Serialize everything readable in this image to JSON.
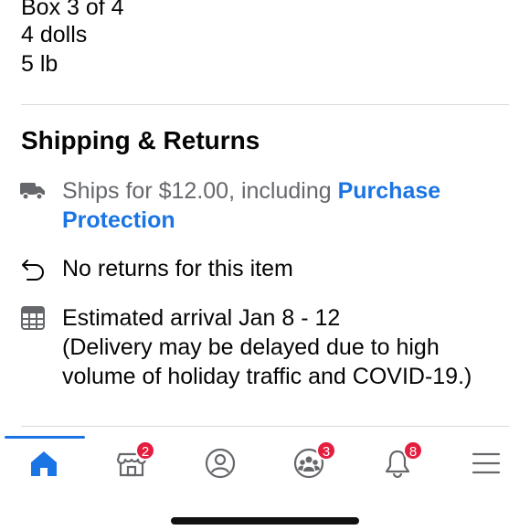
{
  "description": {
    "lines": [
      "Box 3 of 4",
      "4 dolls",
      "5 lb"
    ]
  },
  "shipping": {
    "title": "Shipping & Returns",
    "ships_prefix": "Ships for $12.00, including ",
    "purchase_protection_link": "Purchase Protection",
    "returns_text": "No returns for this item",
    "arrival_text": "Estimated arrival Jan 8 - 12",
    "arrival_note": "(Delivery may be delayed due to high volume of holiday traffic and COVID-19.)"
  },
  "nav": {
    "items": [
      {
        "name": "home",
        "icon": "home-icon",
        "badge": ""
      },
      {
        "name": "marketplace",
        "icon": "marketplace-icon",
        "badge": "2"
      },
      {
        "name": "profile",
        "icon": "profile-icon",
        "badge": ""
      },
      {
        "name": "groups",
        "icon": "groups-icon",
        "badge": "3"
      },
      {
        "name": "notifications",
        "icon": "bell-icon",
        "badge": "8"
      },
      {
        "name": "menu",
        "icon": "menu-icon",
        "badge": ""
      }
    ],
    "active": "home"
  },
  "colors": {
    "accent": "#1b74e4",
    "badge": "#e41e3f",
    "muted_text": "#65676b",
    "divider": "#d9dadc"
  }
}
